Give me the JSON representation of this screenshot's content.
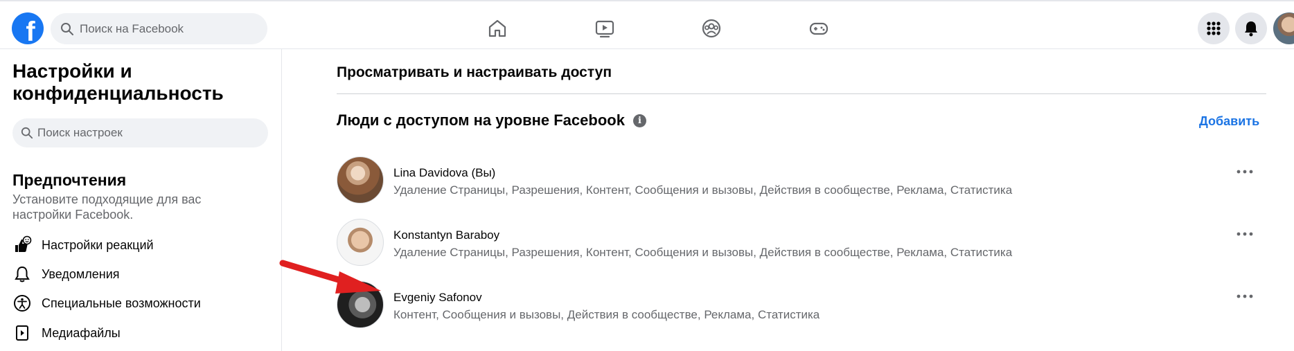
{
  "topbar": {
    "logo": "f",
    "search_placeholder": "Поиск на Facebook",
    "nav_icons": [
      "home-icon",
      "watch-icon",
      "groups-icon",
      "gaming-icon"
    ],
    "right_icons": [
      "menu-grid-icon",
      "notifications-bell-icon",
      "profile-avatar"
    ]
  },
  "sidebar": {
    "title": "Настройки и конфиденциальность",
    "search_placeholder": "Поиск настроек",
    "section_title": "Предпочтения",
    "section_desc": "Установите подходящие для вас настройки Facebook.",
    "items": [
      {
        "label": "Настройки реакций",
        "icon": "reactions-icon"
      },
      {
        "label": "Уведомления",
        "icon": "bell-icon"
      },
      {
        "label": "Специальные возможности",
        "icon": "accessibility-icon"
      },
      {
        "label": "Медиафайлы",
        "icon": "media-icon"
      }
    ]
  },
  "main": {
    "heading": "Просматривать и настраивать доступ",
    "subheading": "Люди с доступом на уровне Facebook",
    "add_label": "Добавить",
    "people": [
      {
        "name": "Lina Davidova (Вы)",
        "permissions": "Удаление Страницы, Разрешения, Контент, Сообщения и вызовы, Действия в сообществе, Реклама, Статистика"
      },
      {
        "name": "Konstantyn Baraboy",
        "permissions": "Удаление Страницы, Разрешения, Контент, Сообщения и вызовы, Действия в сообществе, Реклама, Статистика"
      },
      {
        "name": "Evgeniy Safonov",
        "permissions": "Контент, Сообщения и вызовы, Действия в сообществе, Реклама, Статистика"
      }
    ]
  },
  "colors": {
    "brand": "#1877f2",
    "link": "#1b74e4",
    "annotation_arrow": "#e02020"
  }
}
